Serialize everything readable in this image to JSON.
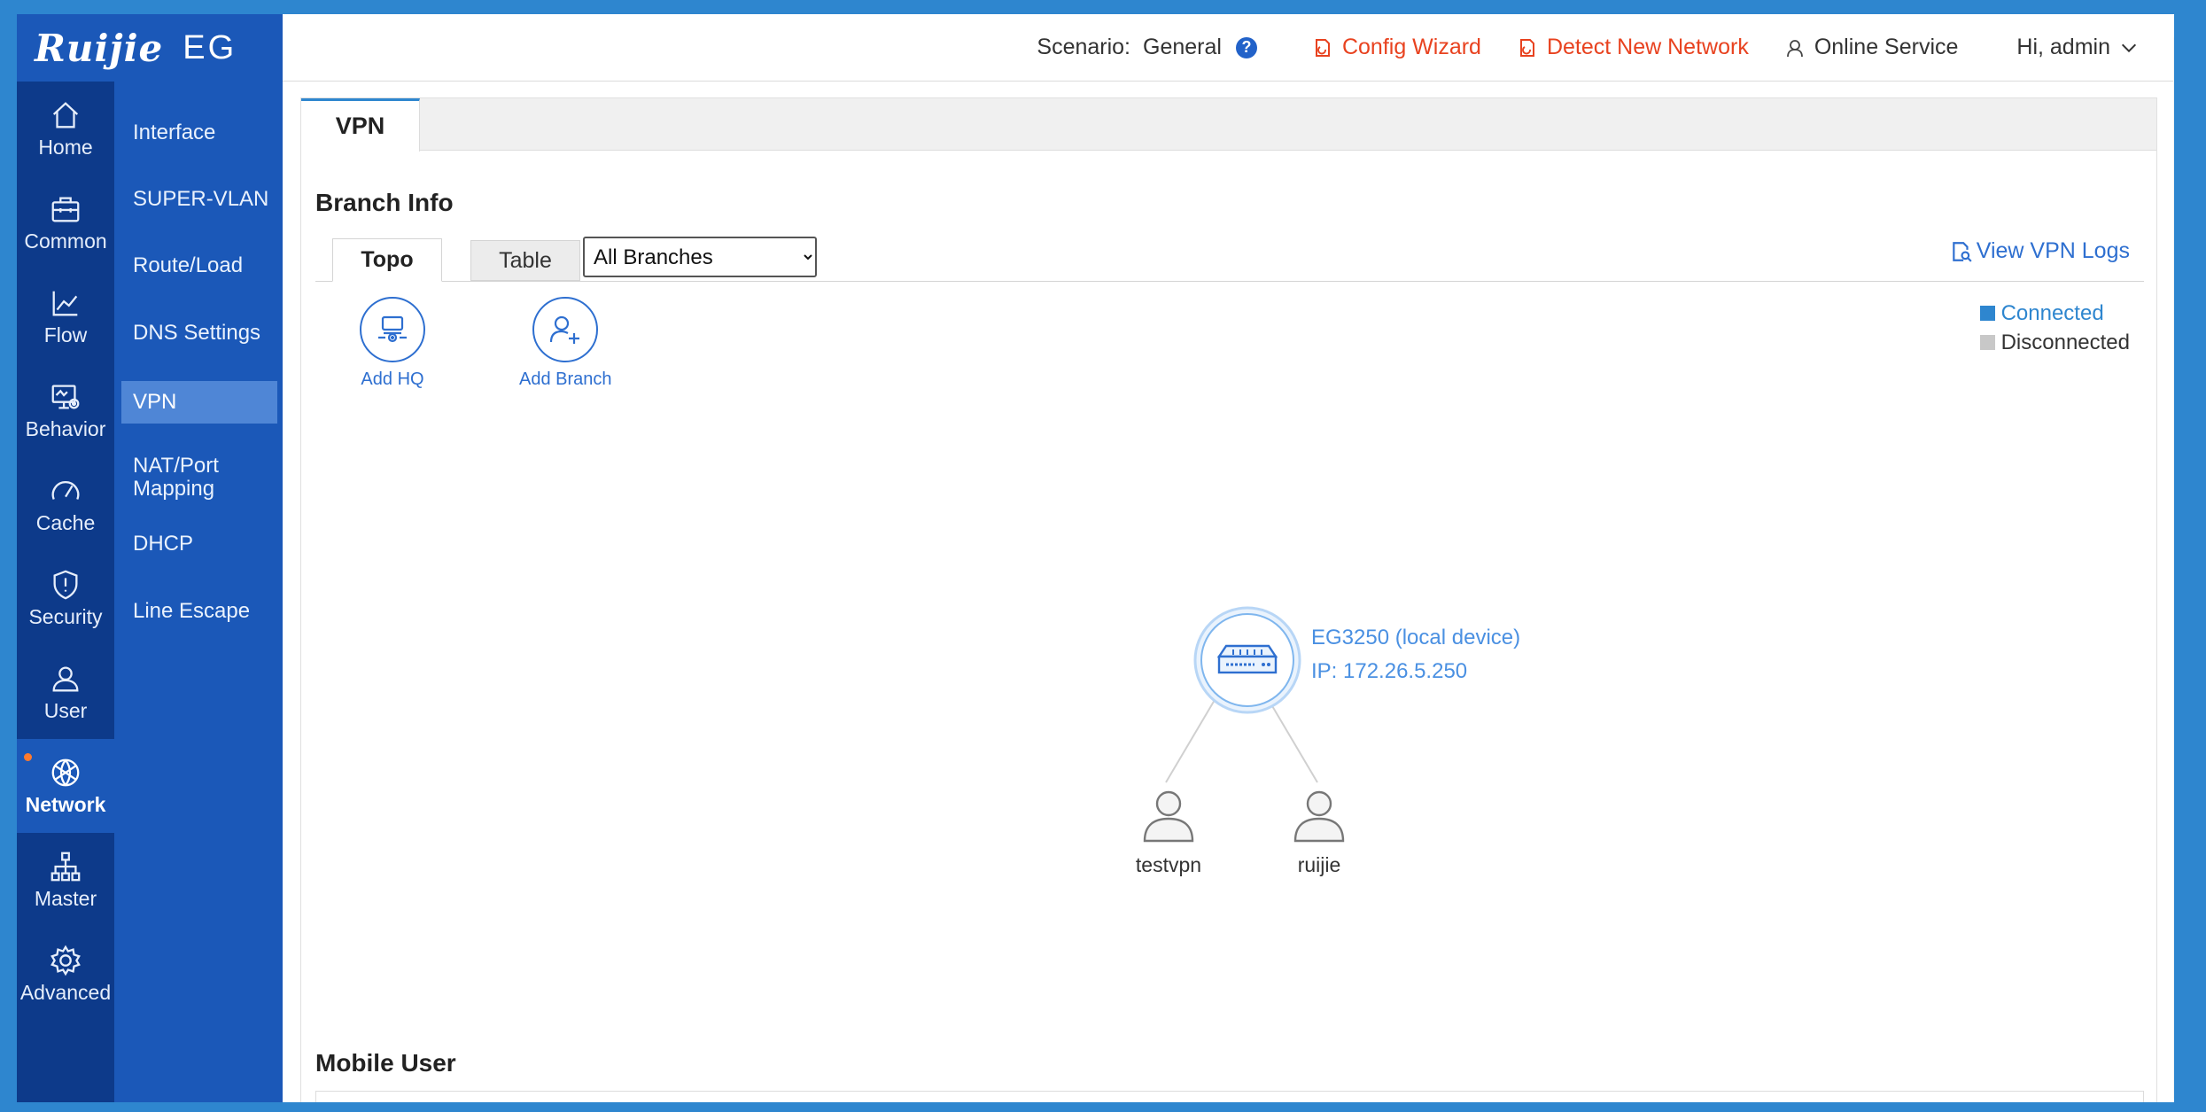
{
  "brand": {
    "logo": "Ruijie",
    "product": "EG"
  },
  "header": {
    "scenario_label": "Scenario:",
    "scenario_value": "General",
    "help": "?",
    "config_wizard": "Config Wizard",
    "detect_network": "Detect New Network",
    "online_service": "Online Service",
    "user_greeting": "Hi, admin"
  },
  "rail": {
    "items": [
      {
        "label": "Home",
        "icon": "home-icon"
      },
      {
        "label": "Common",
        "icon": "briefcase-icon"
      },
      {
        "label": "Flow",
        "icon": "chart-line-icon"
      },
      {
        "label": "Behavior",
        "icon": "monitor-eye-icon"
      },
      {
        "label": "Cache",
        "icon": "speedometer-icon"
      },
      {
        "label": "Security",
        "icon": "shield-icon"
      },
      {
        "label": "User",
        "icon": "user-icon"
      },
      {
        "label": "Network",
        "icon": "globe-icon"
      },
      {
        "label": "Master",
        "icon": "org-chart-icon"
      },
      {
        "label": "Advanced",
        "icon": "gear-icon"
      }
    ],
    "active": "Network"
  },
  "submenu": {
    "items": [
      {
        "label": "Interface"
      },
      {
        "label": "SUPER-VLAN"
      },
      {
        "label": "Route/Load"
      },
      {
        "label": "DNS Settings"
      },
      {
        "label": "VPN"
      },
      {
        "label": "NAT/Port Mapping"
      },
      {
        "label": "DHCP"
      },
      {
        "label": "Line Escape"
      }
    ],
    "active": "VPN"
  },
  "content": {
    "tab": "VPN",
    "branch_info_title": "Branch Info",
    "subtabs": {
      "topo": "Topo",
      "table": "Table"
    },
    "branch_filter": {
      "selected": "All Branches",
      "options": [
        "All Branches"
      ]
    },
    "view_logs": "View VPN Logs",
    "add_hq": "Add HQ",
    "add_branch": "Add Branch",
    "legend": {
      "connected": "Connected",
      "disconnected": "Disconnected",
      "connected_color": "#2e86cf",
      "disconnected_color": "#c8c8c8"
    },
    "topology": {
      "device_name": "EG3250 (local device)",
      "device_ip": "IP: 172.26.5.250",
      "branches": [
        "testvpn",
        "ruijie"
      ]
    },
    "mobile_user_title": "Mobile User"
  },
  "colors": {
    "accent": "#2e86cf",
    "sidebar_dark": "#0d3a8a",
    "sidebar": "#1b58b8",
    "alert": "#e8421f"
  }
}
